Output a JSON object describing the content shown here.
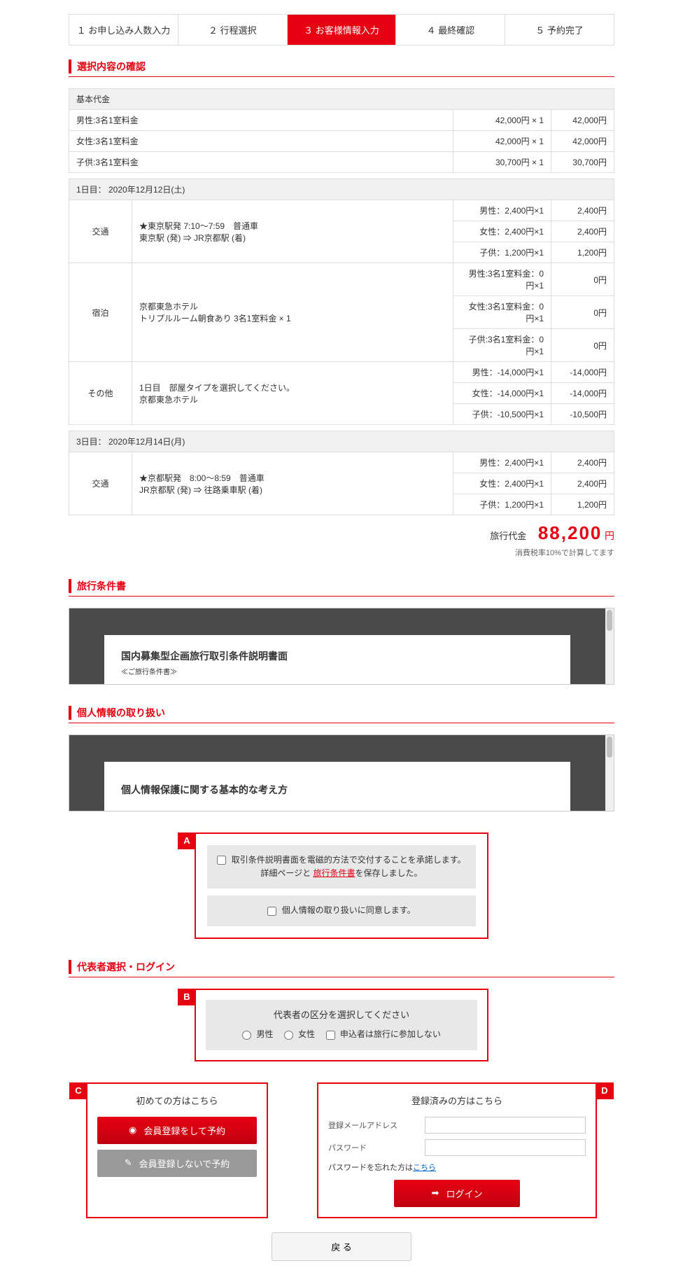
{
  "steps": [
    "１ お申し込み人数入力",
    "２ 行程選択",
    "３ お客様情報入力",
    "４ 最終確認",
    "５ 予約完了"
  ],
  "activeStep": 2,
  "sections": {
    "confirm": "選択内容の確認",
    "terms": "旅行条件書",
    "privacy": "個人情報の取り扱い",
    "rep": "代表者選択・ログイン"
  },
  "baseHeader": "基本代金",
  "baseRows": [
    {
      "label": "男性:3名1室料金",
      "unit": "42,000円 × 1",
      "amt": "42,000円"
    },
    {
      "label": "女性:3名1室料金",
      "unit": "42,000円 × 1",
      "amt": "42,000円"
    },
    {
      "label": "子供:3名1室料金",
      "unit": "30,700円 × 1",
      "amt": "30,700円"
    }
  ],
  "day1": {
    "header": "1日目： 2020年12月12日(土)",
    "groups": [
      {
        "cat": "交通",
        "desc": "★東京駅発 7:10～7:59　普通車\n東京駅 (発)  ⇒ JR京都駅 (着)",
        "rows": [
          {
            "unit": "男性：2,400円×1",
            "amt": "2,400円"
          },
          {
            "unit": "女性：2,400円×1",
            "amt": "2,400円"
          },
          {
            "unit": "子供：1,200円×1",
            "amt": "1,200円"
          }
        ]
      },
      {
        "cat": "宿泊",
        "desc": "京都東急ホテル\nトリプルルーム朝食あり 3名1室料金 × 1",
        "rows": [
          {
            "unit": "男性:3名1室料金：0円×1",
            "amt": "0円"
          },
          {
            "unit": "女性:3名1室料金：0円×1",
            "amt": "0円"
          },
          {
            "unit": "子供:3名1室料金：0円×1",
            "amt": "0円"
          }
        ]
      },
      {
        "cat": "その他",
        "desc": "1日目　部屋タイプを選択してください。\n京都東急ホテル",
        "rows": [
          {
            "unit": "男性：-14,000円×1",
            "amt": "-14,000円"
          },
          {
            "unit": "女性：-14,000円×1",
            "amt": "-14,000円"
          },
          {
            "unit": "子供：-10,500円×1",
            "amt": "-10,500円"
          }
        ]
      }
    ]
  },
  "day3": {
    "header": "3日目： 2020年12月14日(月)",
    "groups": [
      {
        "cat": "交通",
        "desc": "★京都駅発　8:00～8:59　普通車\nJR京都駅 (発)  ⇒ 往路乗車駅 (着)",
        "rows": [
          {
            "unit": "男性：2,400円×1",
            "amt": "2,400円"
          },
          {
            "unit": "女性：2,400円×1",
            "amt": "2,400円"
          },
          {
            "unit": "子供：1,200円×1",
            "amt": "1,200円"
          }
        ]
      }
    ]
  },
  "total": {
    "label": "旅行代金",
    "amount": "88,200",
    "yen": "円",
    "tax": "消費税率10%で計算してます"
  },
  "doc1": {
    "title": "国内募集型企画旅行取引条件説明書面",
    "sub": "≪ご旅行条件書≫"
  },
  "doc2": {
    "title": "個人情報保護に関する基本的な考え方"
  },
  "markers": {
    "a": "A",
    "b": "B",
    "c": "C",
    "d": "D"
  },
  "agree": {
    "line1a": "取引条件説明書面を電磁的方法で交付することを承諾します。",
    "line1b": "詳細ページと ",
    "line1link": "旅行条件書",
    "line1c": "を保存しました。",
    "line2": "個人情報の取り扱いに同意します。"
  },
  "rep": {
    "title": "代表者の区分を選択してください",
    "male": "男性",
    "female": "女性",
    "none": "申込者は旅行に参加しない"
  },
  "panelC": {
    "title": "初めての方はこちら",
    "btn1": "会員登録をして予約",
    "btn2": "会員登録しないで予約"
  },
  "panelD": {
    "title": "登録済みの方はこちら",
    "email": "登録メールアドレス",
    "password": "パスワード",
    "forgot": "パスワードを忘れた方は",
    "forgotLink": "こちら",
    "login": "ログイン"
  },
  "back": "戻 る"
}
